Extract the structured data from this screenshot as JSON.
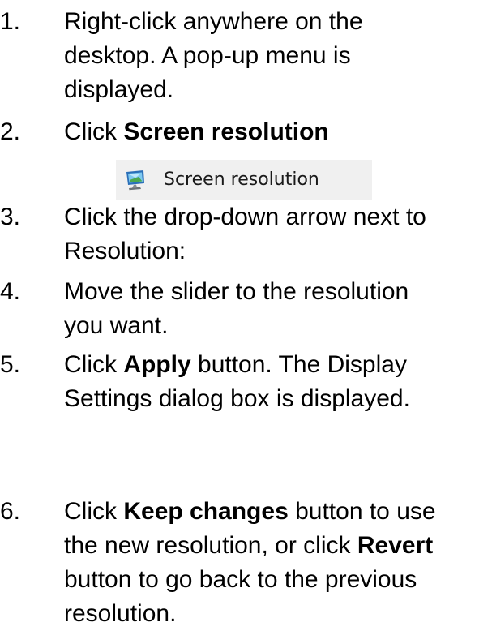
{
  "steps": [
    {
      "number": "1.",
      "lines": [
        "Right-click anywhere on the",
        "desktop. A pop-up menu is",
        "displayed."
      ]
    },
    {
      "number": "2.",
      "prefix": "Click ",
      "bold": "Screen resolution"
    },
    {
      "number": "3.",
      "lines": [
        "Click the drop-down arrow next to",
        "Resolution:"
      ]
    },
    {
      "number": "4.",
      "lines": [
        "Move the slider to the resolution",
        "you want."
      ]
    },
    {
      "number": "5.",
      "prefix": "Click ",
      "bold": "Apply",
      "suffix": " button. The Display",
      "line2": "Settings dialog box is displayed."
    },
    {
      "number": "6.",
      "prefix": "Click ",
      "bold": "Keep changes",
      "suffix": " button to use",
      "line2_prefix": "the new resolution, or click ",
      "line2_bold": "Revert",
      "line3": "button to go back to the previous",
      "line4": "resolution."
    }
  ],
  "menu_item": {
    "label": "Screen resolution",
    "icon": "monitor-icon"
  }
}
